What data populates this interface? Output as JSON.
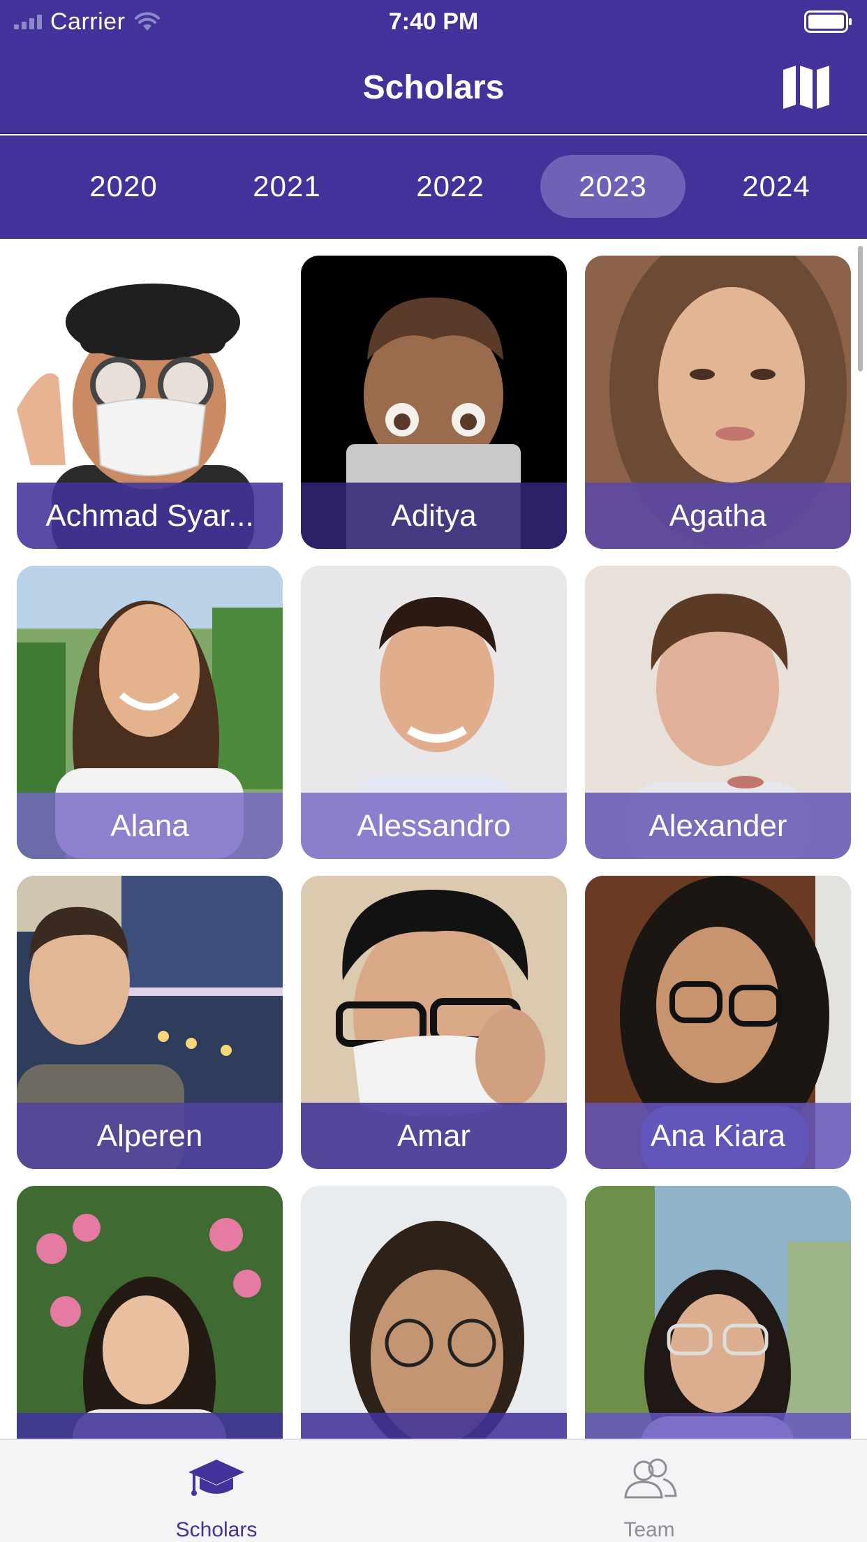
{
  "status_bar": {
    "carrier": "Carrier",
    "time": "7:40 PM"
  },
  "nav": {
    "title": "Scholars",
    "map_icon": "map-icon"
  },
  "years": {
    "items": [
      "2020",
      "2021",
      "2022",
      "2023",
      "2024"
    ],
    "selected": "2023"
  },
  "scholars": [
    {
      "name": "Achmad Syar...",
      "photo": "memoji-cap-glasses-mask"
    },
    {
      "name": "Aditya",
      "photo": "memoji-laptop"
    },
    {
      "name": "Agatha",
      "photo": "portrait"
    },
    {
      "name": "Alana",
      "photo": "portrait-outdoor"
    },
    {
      "name": "Alessandro",
      "photo": "portrait"
    },
    {
      "name": "Alexander",
      "photo": "portrait"
    },
    {
      "name": "Alperen",
      "photo": "portrait-bridge-night"
    },
    {
      "name": "Amar",
      "photo": "portrait-mask"
    },
    {
      "name": "Ana Kiara",
      "photo": "portrait-glasses"
    },
    {
      "name": "",
      "photo": "portrait-flowers"
    },
    {
      "name": "",
      "photo": "portrait-glasses"
    },
    {
      "name": "",
      "photo": "portrait-outdoor"
    }
  ],
  "tabs": [
    {
      "label": "Scholars",
      "icon": "graduation-cap-icon",
      "active": true
    },
    {
      "label": "Team",
      "icon": "people-icon",
      "active": false
    }
  ],
  "colors": {
    "primary": "#41339a",
    "selected_pill": "#6d62b5",
    "tab_inactive": "#8e8e93"
  }
}
